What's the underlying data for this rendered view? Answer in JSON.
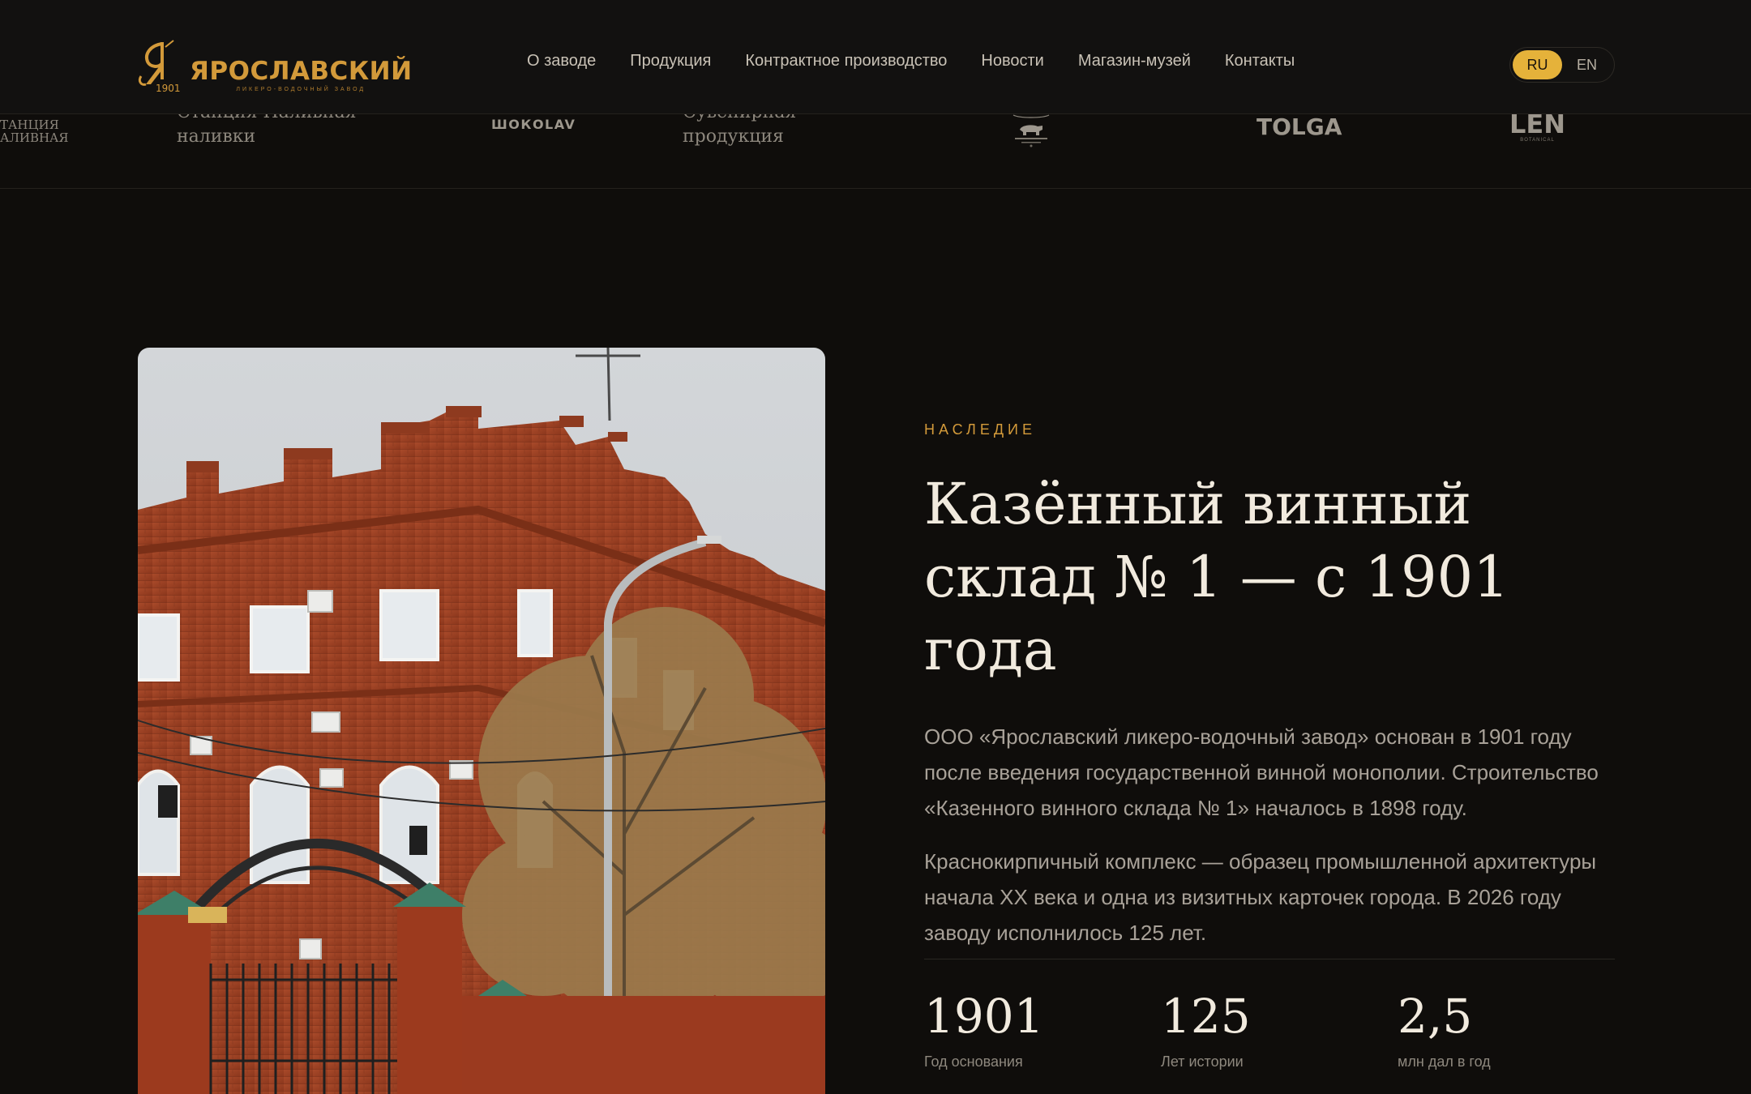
{
  "header": {
    "logo": {
      "title": "ЯРОСЛАВСКИЙ",
      "subtitle": "ЛИКЕРО-ВОДОЧНЫЙ ЗАВОД",
      "year": "1901"
    },
    "nav": [
      "О заводе",
      "Продукция",
      "Контрактное производство",
      "Новости",
      "Магазин-музей",
      "Контакты"
    ],
    "lang": {
      "active": "RU",
      "inactive": "EN"
    }
  },
  "brands": {
    "cut_left": [
      "ТАНЦИЯ",
      "АЛИВНАЯ"
    ],
    "station": [
      "Станция Наливная",
      "наливки"
    ],
    "shokolav": "ШОКОLAV",
    "souvenir": [
      "Сувенирная",
      "продукция"
    ],
    "bear_icon": "bear-emblem-icon",
    "tolga": "TOLGA",
    "len": "LEN",
    "len_sub": "BOTANICAL"
  },
  "colors": {
    "background": "#0f0d0b",
    "accent": "#e5b23a",
    "eyebrow": "#d39a3a"
  },
  "section": {
    "eyebrow": "НАСЛЕДИЕ",
    "title_line1": "Казённый винный",
    "title_line2": "склад № 1 — с 1901 года",
    "paragraph1": "ООО «Ярославский ликеро-водочный завод» основан в 1901 году после введения государственной винной монополии. Строительство «Казенного винного склада № 1» началось в 1898 году.",
    "paragraph2": "Краснокирпичный комплекс — образец промышленной архитектуры начала XX века и одна из визитных карточек города. В 2026 году заводу исполнилось 125 лет."
  },
  "stats": [
    {
      "value": "1901",
      "label": "Год основания"
    },
    {
      "value": "125",
      "label": "Лет истории"
    },
    {
      "value": "2,5",
      "label": "млн дал в год"
    }
  ]
}
